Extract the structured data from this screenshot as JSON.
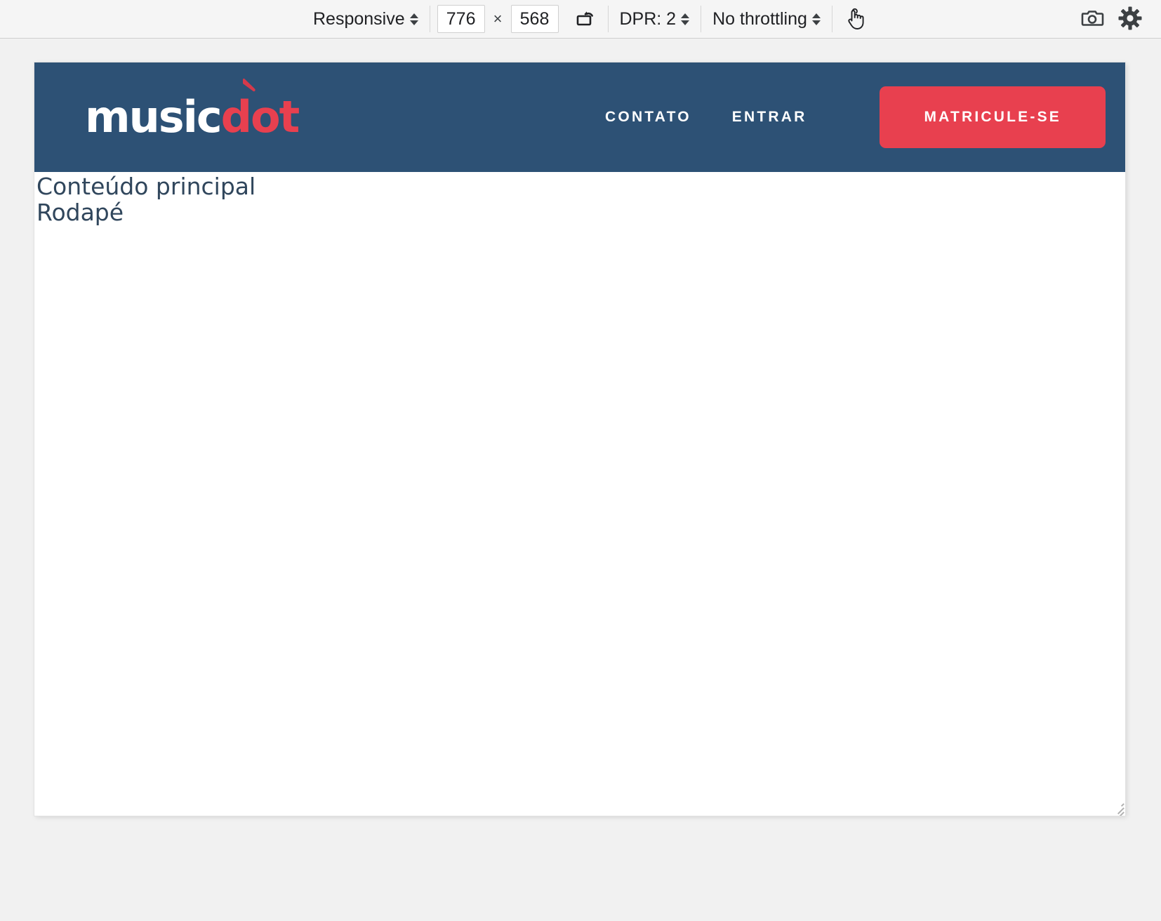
{
  "devtools_toolbar": {
    "device_select": {
      "label": "Responsive",
      "icon": "chevron-updown-icon"
    },
    "width_input": {
      "value": "776"
    },
    "dimension_separator": "×",
    "height_input": {
      "value": "568"
    },
    "rotate_button": {
      "icon": "rotate-device-icon",
      "title": "Rotate"
    },
    "dpr_select": {
      "label": "DPR: 2",
      "icon": "chevron-updown-icon"
    },
    "throttling_select": {
      "label": "No throttling",
      "icon": "chevron-updown-icon"
    },
    "touch_button": {
      "icon": "touch-cursor-icon",
      "title": "Touch"
    },
    "screenshot_button": {
      "icon": "camera-icon",
      "title": "Capture screenshot"
    },
    "settings_button": {
      "icon": "gear-icon",
      "title": "Settings"
    }
  },
  "viewport": {
    "resize_grip": {
      "icon": "resize-handle-icon"
    }
  },
  "page": {
    "header": {
      "logo": {
        "part_white": "music",
        "part_red": "dot",
        "note_icon": "music-note-icon"
      },
      "nav_links": [
        {
          "label": "CONTATO"
        },
        {
          "label": "ENTRAR"
        }
      ],
      "cta": {
        "label": "MATRICULE-SE"
      }
    },
    "main": {
      "text": "Conteúdo principal"
    },
    "footer": {
      "text": "Rodapé"
    }
  },
  "colors": {
    "header_bg": "#2D5175",
    "accent_red": "#E8404F",
    "body_text": "#30465C",
    "toolbar_bg": "#F5F5F5",
    "page_bg": "#F1F1F1"
  }
}
